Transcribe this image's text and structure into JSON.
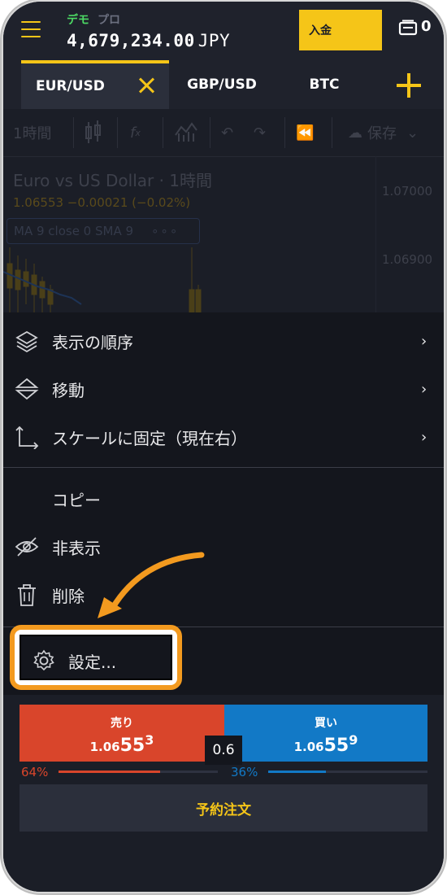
{
  "header": {
    "mode_demo": "デモ",
    "mode_pro": "プロ",
    "balance_value": "4,679,234.00",
    "balance_currency": "JPY",
    "deposit_label": "入金",
    "wallet_count": "0"
  },
  "tabs": [
    {
      "label": "EUR/USD",
      "active": true
    },
    {
      "label": "GBP/USD",
      "active": false
    },
    {
      "label": "BTC",
      "active": false
    }
  ],
  "chart": {
    "interval": "1時間",
    "save_label": "保存",
    "title": "Euro vs US Dollar · 1時間",
    "quote": "1.06553 −0.00021 (−0.02%)",
    "indicator": "MA 9 close 0 SMA 9",
    "indicator_more": "∘∘∘",
    "price_levels": [
      "1.07000",
      "1.06900"
    ]
  },
  "menu": {
    "items": [
      {
        "label": "表示の順序",
        "icon": "layers-icon",
        "submenu": true
      },
      {
        "label": "移動",
        "icon": "move-icon",
        "submenu": true
      },
      {
        "label": "スケールに固定（現在右）",
        "icon": "axis-icon",
        "submenu": true
      },
      {
        "label": "コピー",
        "icon": "",
        "submenu": false
      },
      {
        "label": "非表示",
        "icon": "eye-off-icon",
        "submenu": false
      },
      {
        "label": "削除",
        "icon": "trash-icon",
        "submenu": false
      },
      {
        "label": "設定...",
        "icon": "gear-icon",
        "submenu": false
      }
    ],
    "chevron": "›"
  },
  "trade": {
    "sell_label": "売り",
    "sell_price_prefix": "1.06",
    "sell_price_main": "55",
    "sell_price_sup": "3",
    "buy_label": "買い",
    "buy_price_prefix": "1.06",
    "buy_price_main": "55",
    "buy_price_sup": "9",
    "spread": "0.6",
    "sell_pct": "64%",
    "buy_pct": "36%",
    "sell_ratio": 0.64,
    "buy_ratio": 0.36,
    "order_label": "予約注文"
  },
  "colors": {
    "accent": "#f5c518",
    "sell": "#d9452b",
    "buy": "#1279c6",
    "highlight": "#f39a1f"
  }
}
